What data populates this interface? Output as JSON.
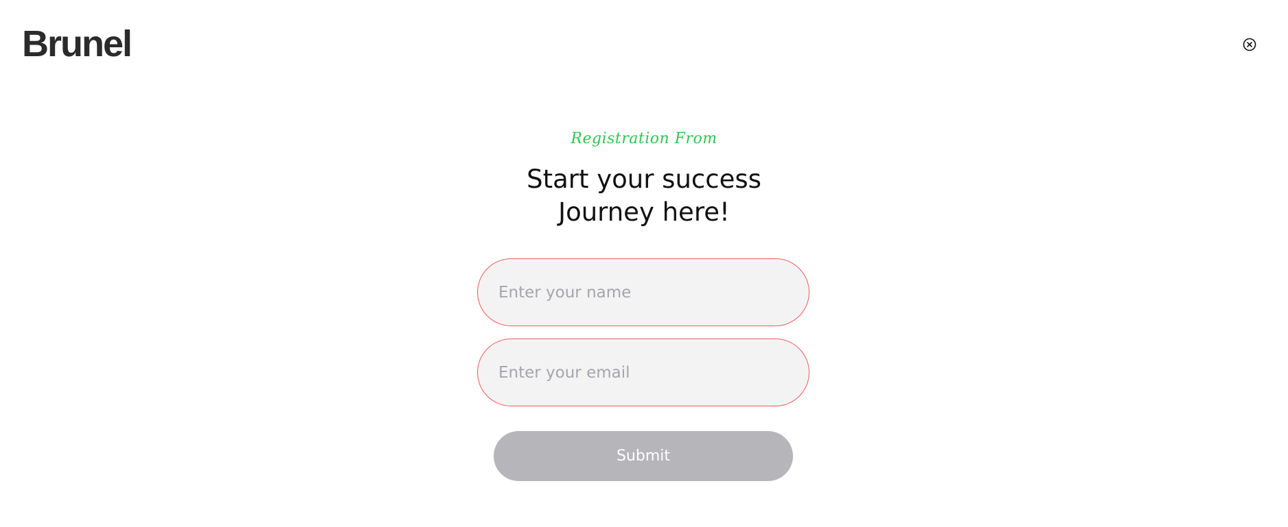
{
  "header": {
    "logo_text": "Brunel",
    "close_icon": "close-circle-icon"
  },
  "form": {
    "subtitle": "Registration From",
    "title_line1": "Start your success",
    "title_line2": "Journey here!",
    "name_placeholder": "Enter your name",
    "name_value": "",
    "email_placeholder": "Enter your email",
    "email_value": "",
    "submit_label": "Submit"
  },
  "colors": {
    "accent_green": "#2dc653",
    "field_border": "#f05a5a",
    "field_bg": "#f3f3f3",
    "submit_disabled": "#b5b5ba",
    "logo": "#2b2b2b"
  }
}
